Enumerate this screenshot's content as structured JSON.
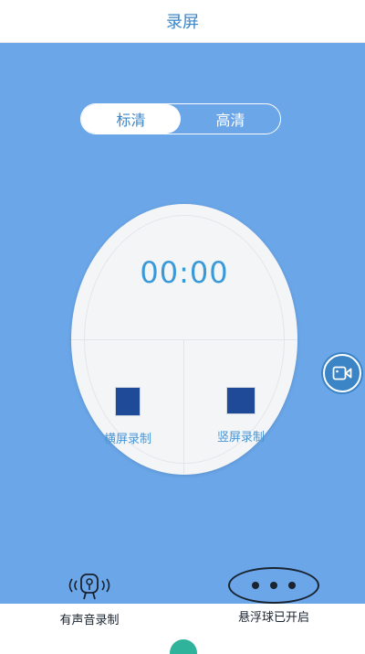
{
  "header": {
    "title": "录屏"
  },
  "quality": {
    "options": [
      {
        "label": "标清",
        "selected": true
      },
      {
        "label": "高清",
        "selected": false
      }
    ]
  },
  "recorder": {
    "timer": "00:00",
    "landscape_label": "横屏录制",
    "portrait_label": "竖屏录制"
  },
  "bottom": {
    "audio_label": "有声音录制",
    "float_ball_label": "悬浮球已开启"
  },
  "colors": {
    "background": "#6aa6e8",
    "accent": "#3a86c8",
    "record_icon": "#1e4a97"
  },
  "icons": {
    "floating": "video-camera-icon",
    "audio": "microphone-sound-icon"
  }
}
